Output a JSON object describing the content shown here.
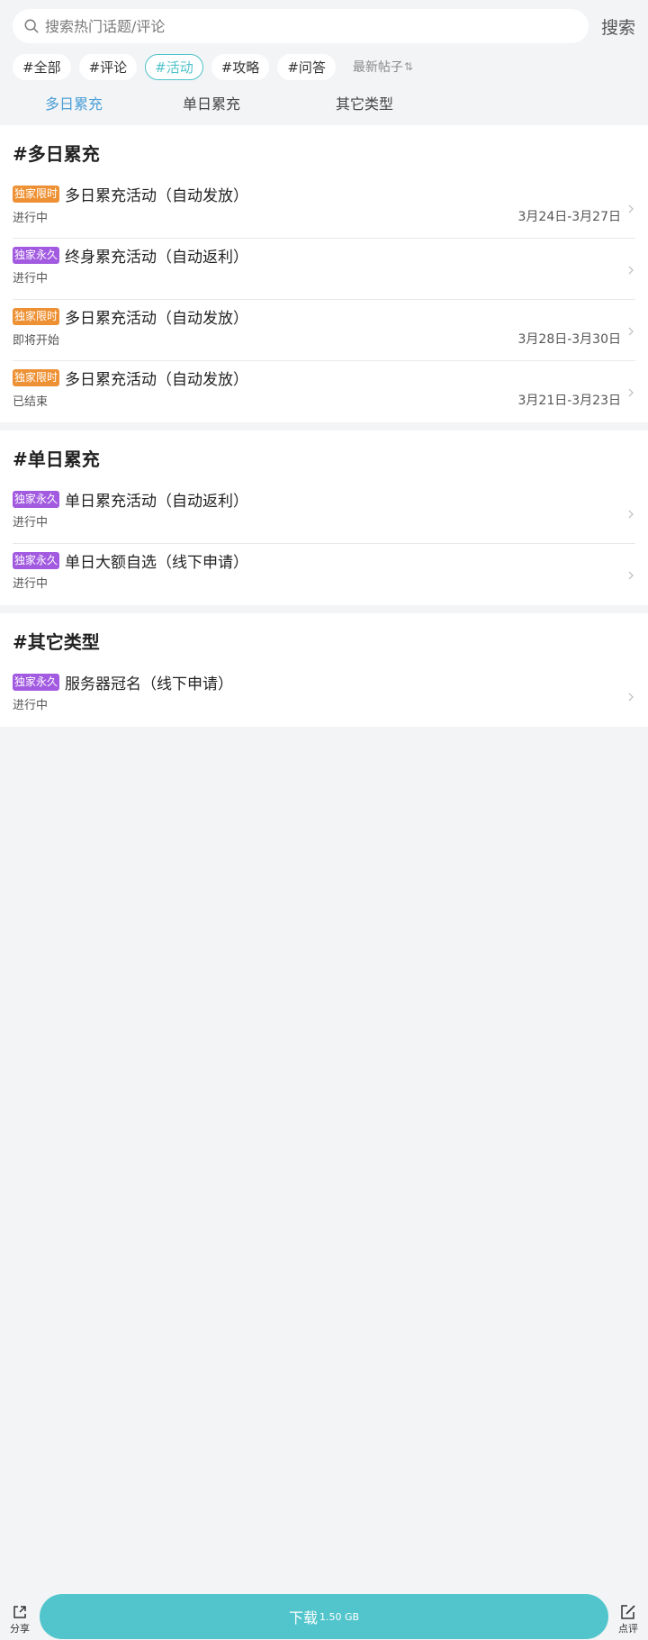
{
  "search": {
    "placeholder": "搜索热门话题/评论",
    "button_label": "搜索"
  },
  "chips": [
    {
      "label": "#全部",
      "active": false
    },
    {
      "label": "#评论",
      "active": false
    },
    {
      "label": "#活动",
      "active": true
    },
    {
      "label": "#攻略",
      "active": false
    },
    {
      "label": "#问答",
      "active": false
    }
  ],
  "sort": {
    "label": "最新帖子",
    "icon": "sort-arrows-icon"
  },
  "sub_tabs": [
    {
      "label": "多日累充",
      "active": true
    },
    {
      "label": "单日累充",
      "active": false
    },
    {
      "label": "其它类型",
      "active": false
    }
  ],
  "sections": [
    {
      "title": "#多日累充",
      "items": [
        {
          "badge": "独家限时",
          "badge_type": "limited",
          "title": "多日累充活动（自动发放）",
          "status": "进行中",
          "date": "3月24日-3月27日"
        },
        {
          "badge": "独家永久",
          "badge_type": "forever",
          "title": "终身累充活动（自动返利）",
          "status": "进行中",
          "date": ""
        },
        {
          "badge": "独家限时",
          "badge_type": "limited",
          "title": "多日累充活动（自动发放）",
          "status": "即将开始",
          "date": "3月28日-3月30日"
        },
        {
          "badge": "独家限时",
          "badge_type": "limited",
          "title": "多日累充活动（自动发放）",
          "status": "已结束",
          "date": "3月21日-3月23日"
        }
      ]
    },
    {
      "title": "#单日累充",
      "items": [
        {
          "badge": "独家永久",
          "badge_type": "forever",
          "title": "单日累充活动（自动返利）",
          "status": "进行中",
          "date": ""
        },
        {
          "badge": "独家永久",
          "badge_type": "forever",
          "title": "单日大额自选（线下申请）",
          "status": "进行中",
          "date": ""
        }
      ]
    },
    {
      "title": "#其它类型",
      "items": [
        {
          "badge": "独家永久",
          "badge_type": "forever",
          "title": "服务器冠名（线下申请）",
          "status": "进行中",
          "date": ""
        }
      ]
    }
  ],
  "bottom_bar": {
    "share_label": "分享",
    "download_label": "下载",
    "download_size": "1.50 GB",
    "review_label": "点评"
  },
  "colors": {
    "accent": "#4fc2c9",
    "tab_active": "#4b9fd7",
    "badge_limited": "#ee9134",
    "badge_forever": "#a25be0",
    "download_bg": "#52c5cc"
  }
}
